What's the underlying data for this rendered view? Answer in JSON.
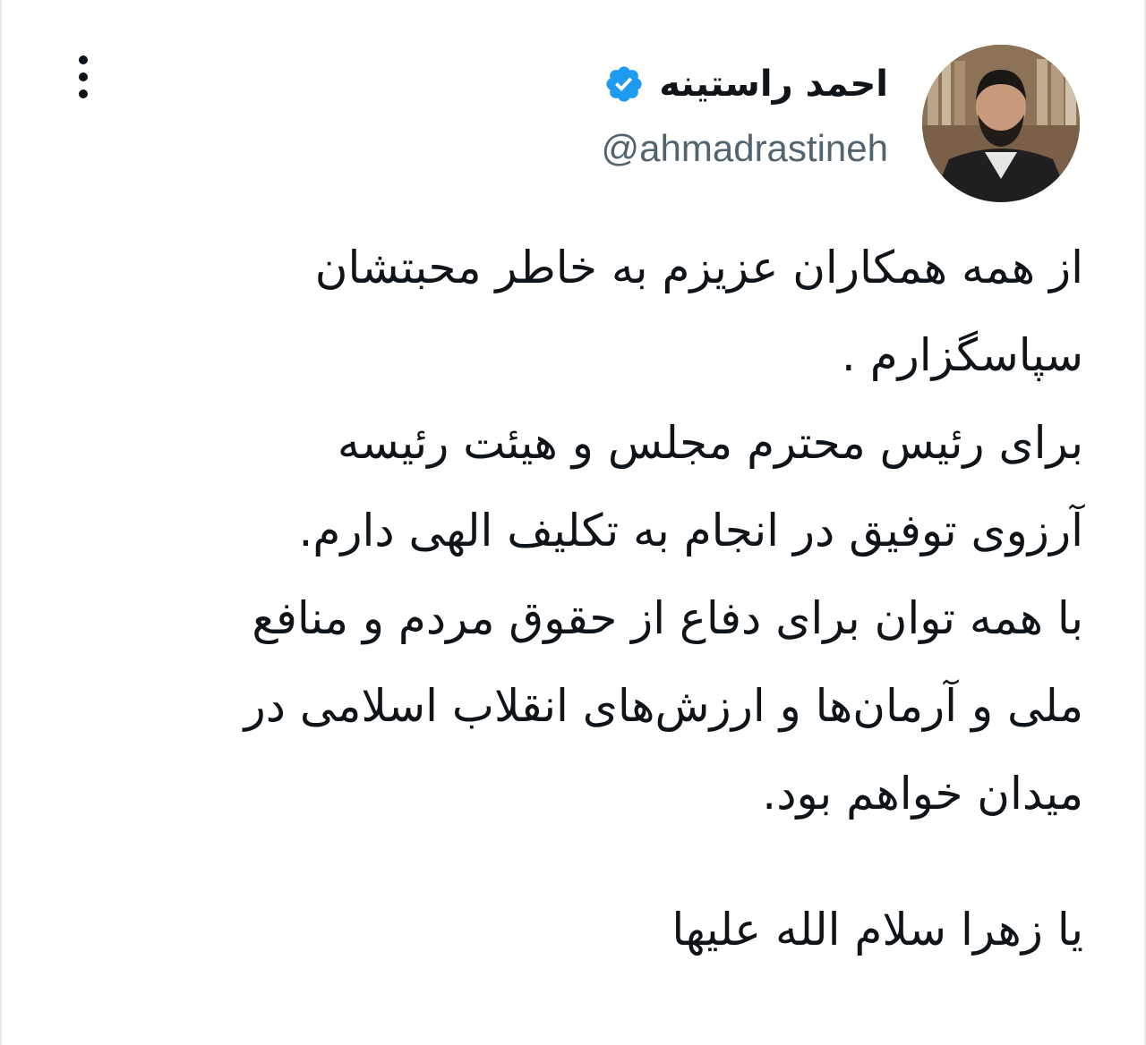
{
  "tweet": {
    "author": {
      "display_name": "احمد راستینه",
      "handle": "@ahmadrastineh",
      "verified": true,
      "avatar_icon": "profile-photo"
    },
    "menu_icon": "more-vertical-icon",
    "text_lines": [
      "از همه همکاران عزیزم به خاطر محبتشان",
      "سپاسگزارم .",
      "برای رئیس محترم مجلس و هیئت رئیسه",
      "آرزوی توفیق در انجام به تکلیف الهی دارم.",
      "با همه توان برای دفاع از حقوق مردم و منافع",
      "ملی و آرمان‌ها و ارزش‌های انقلاب اسلامی در",
      "میدان خواهم بود."
    ],
    "closing_line": "یا زهرا سلام الله علیها"
  },
  "colors": {
    "text": "#0f1419",
    "secondary_text": "#536471",
    "verified_blue": "#1d9bf0",
    "border": "#e6e8ea"
  }
}
